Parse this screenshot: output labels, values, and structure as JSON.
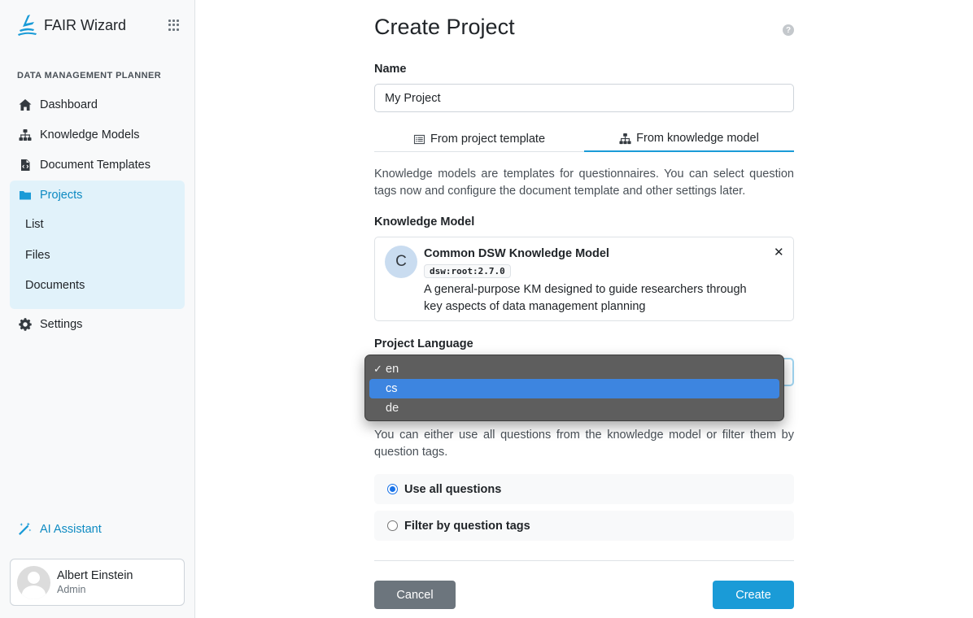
{
  "app": {
    "name": "FAIR Wizard"
  },
  "sidebar": {
    "section_title": "DATA MANAGEMENT PLANNER",
    "items": [
      {
        "label": "Dashboard",
        "icon": "home-icon"
      },
      {
        "label": "Knowledge Models",
        "icon": "sitemap-icon"
      },
      {
        "label": "Document Templates",
        "icon": "file-code-icon"
      },
      {
        "label": "Projects",
        "icon": "folder-icon",
        "active": true
      },
      {
        "label": "Settings",
        "icon": "gear-icon"
      }
    ],
    "project_sub_items": [
      {
        "label": "List"
      },
      {
        "label": "Files"
      },
      {
        "label": "Documents"
      }
    ],
    "ai_assistant": "AI Assistant",
    "user": {
      "name": "Albert Einstein",
      "role": "Admin"
    }
  },
  "page": {
    "title": "Create Project",
    "name_label": "Name",
    "name_value": "My Project",
    "tabs": [
      {
        "label": "From project template",
        "icon": "list-icon"
      },
      {
        "label": "From knowledge model",
        "icon": "sitemap-icon",
        "active": true
      }
    ],
    "km_description": "Knowledge models are templates for questionnaires. You can select question tags now and configure the document template and other settings later.",
    "km_label": "Knowledge Model",
    "km": {
      "initial": "C",
      "name": "Common DSW Knowledge Model",
      "id": "dsw:root:2.7.0",
      "description": "A general-purpose KM designed to guide researchers through key aspects of data management planning"
    },
    "language_label": "Project Language",
    "language_options": [
      {
        "label": "en",
        "selected": true
      },
      {
        "label": "cs",
        "highlighted": true
      },
      {
        "label": "de"
      }
    ],
    "filter_description": "You can either use all questions from the knowledge model or filter them by question tags.",
    "radio_options": [
      {
        "label": "Use all questions",
        "checked": true
      },
      {
        "label": "Filter by question tags"
      }
    ],
    "cancel_label": "Cancel",
    "create_label": "Create"
  },
  "colors": {
    "accent": "#1a9bd7",
    "active_bg": "#e1f2fa",
    "cancel": "#6c757d"
  }
}
